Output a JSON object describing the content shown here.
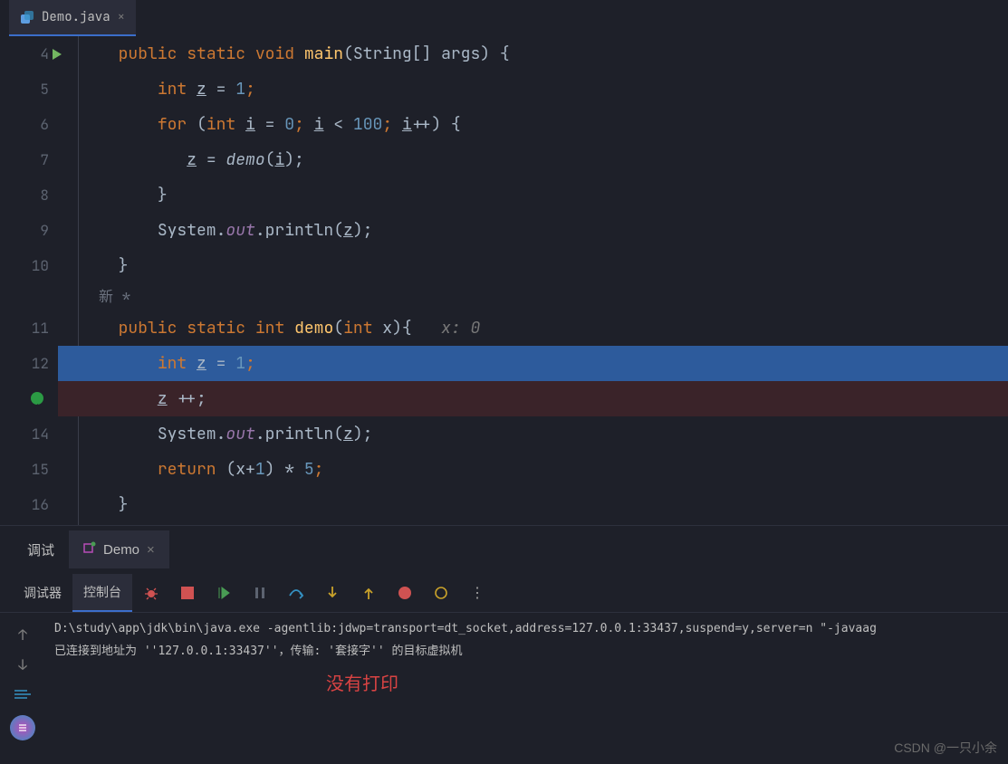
{
  "tabs": {
    "file_tab": {
      "label": "Demo.java"
    }
  },
  "gutter": [
    "4",
    "5",
    "6",
    "7",
    "8",
    "9",
    "10",
    "",
    "11",
    "12",
    "",
    "14",
    "15",
    "16"
  ],
  "code": {
    "line4": {
      "public": "public",
      "static": "static",
      "void": "void",
      "main": "main",
      "rest": "(String[] args) {"
    },
    "line5": {
      "int": "int",
      "z": "z",
      "eq": " = ",
      "one": "1",
      "semi": ";"
    },
    "line6": {
      "for": "for",
      "open": " (",
      "int": "int",
      "i": "i",
      "eq": " = ",
      "zero": "0",
      "semi": "; ",
      "i2": "i",
      "lt": " < ",
      "hundred": "100",
      "semi2": "; ",
      "i3": "i",
      "inc": "++) {"
    },
    "line7": {
      "z": "z",
      "eq": " = ",
      "demo": "demo",
      "open": "(",
      "i": "i",
      "close": ");"
    },
    "line8": {
      "brace": "}"
    },
    "line9": {
      "sys": "System.",
      "out": "out",
      "print": ".println(",
      "z": "z",
      "close": ");"
    },
    "line10": {
      "brace": "}"
    },
    "annotation_new": "新 *",
    "line11": {
      "public": "public",
      "static": "static",
      "int": "int",
      "demo": "demo",
      "open": "(",
      "intparam": "int",
      "x": " x){",
      "hint": "x: 0"
    },
    "line12": {
      "int": "int",
      "z": "z",
      "eq": " = ",
      "one": "1",
      "semi": ";"
    },
    "line13_bp": {
      "z": "z",
      "inc": " ++;"
    },
    "line14": {
      "sys": "System.",
      "out": "out",
      "print": ".println(",
      "z": "z",
      "close": ");"
    },
    "line15": {
      "return": "return",
      "open": " (x+",
      "one": "1",
      "close": ") * ",
      "five": "5",
      "semi": ";"
    },
    "line16": {
      "brace": "}"
    }
  },
  "panel": {
    "debug_label": "调试",
    "demo_tab": "Demo",
    "debugger_tab": "调试器",
    "console_tab": "控制台"
  },
  "console": {
    "line1": "D:\\study\\app\\jdk\\bin\\java.exe -agentlib:jdwp=transport=dt_socket,address=127.0.0.1:33437,suspend=y,server=n \"-javaag",
    "line2": "已连接到地址为 ''127.0.0.1:33437''，传输: '套接字'' 的目标虚拟机",
    "annotation": "没有打印"
  },
  "watermark": "CSDN @一只小余"
}
